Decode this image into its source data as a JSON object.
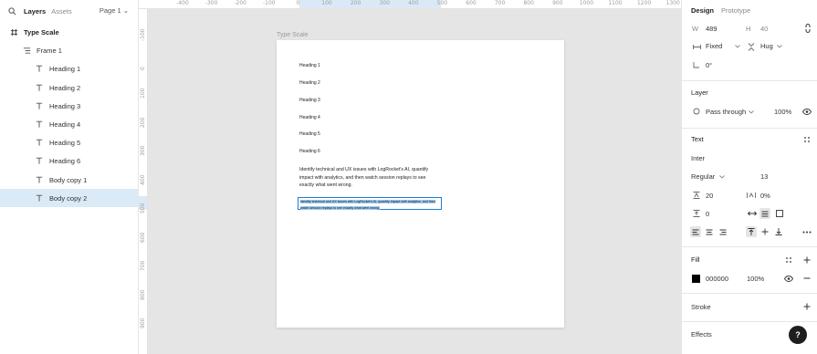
{
  "left_panel": {
    "tabs": {
      "layers": "Layers",
      "assets": "Assets"
    },
    "page_selector": "Page 1 ⌄",
    "layers": [
      {
        "name": "Type Scale",
        "kind": "frame-root"
      },
      {
        "name": "Frame 1",
        "kind": "frame"
      },
      {
        "name": "Heading 1",
        "kind": "text"
      },
      {
        "name": "Heading 2",
        "kind": "text"
      },
      {
        "name": "Heading 3",
        "kind": "text"
      },
      {
        "name": "Heading 4",
        "kind": "text"
      },
      {
        "name": "Heading 5",
        "kind": "text"
      },
      {
        "name": "Heading 6",
        "kind": "text"
      },
      {
        "name": "Body copy 1",
        "kind": "text"
      },
      {
        "name": "Body copy 2",
        "kind": "text",
        "selected": true
      }
    ]
  },
  "rulers": {
    "top": [
      "-400",
      "-300",
      "-200",
      "-100",
      "0",
      "100",
      "200",
      "300",
      "400",
      "500",
      "600",
      "700",
      "800",
      "900",
      "1000",
      "1100",
      "1200",
      "1300"
    ],
    "left": [
      "-100",
      "0",
      "100",
      "200",
      "300",
      "400",
      "500",
      "600",
      "700",
      "800",
      "900"
    ]
  },
  "canvas": {
    "frame_label": "Type Scale",
    "headings": [
      "Heading 1",
      "Heading 2",
      "Heading 3",
      "Heading 4",
      "Heading 5",
      "Heading 6"
    ],
    "body_copy_1": "Identify technical and UX issues with LogRocket's AI, quantify impact with analytics, and then watch session replays to see exactly what went wrong.",
    "body_copy_2": "Identify technical and UX issues with LogRocket's AI, quantify impact with analytics, and then watch session replays to see exactly what went wrong."
  },
  "right_panel": {
    "tabs": {
      "design": "Design",
      "prototype": "Prototype"
    },
    "dimensions": {
      "w_label": "W",
      "w_value": "489",
      "h_label": "H",
      "h_value": "40"
    },
    "resizing": {
      "horizontal": "Fixed",
      "vertical": "Hug"
    },
    "rotation": "0°",
    "layer": {
      "title": "Layer",
      "blend": "Pass through",
      "opacity": "100%"
    },
    "text": {
      "title": "Text",
      "font_family": "Inter",
      "font_weight": "Regular",
      "font_size": "13",
      "line_height": "20",
      "letter_spacing": "0%",
      "paragraph_spacing": "0"
    },
    "fill": {
      "title": "Fill",
      "hex": "000000",
      "opacity": "100%",
      "color": "#000000"
    },
    "stroke": {
      "title": "Stroke"
    },
    "effects": {
      "title": "Effects"
    },
    "help": "?"
  },
  "colors": {
    "selection": "#1c7ed6",
    "selected_row": "#daebf7",
    "text_highlight": "#9ecbf2"
  }
}
